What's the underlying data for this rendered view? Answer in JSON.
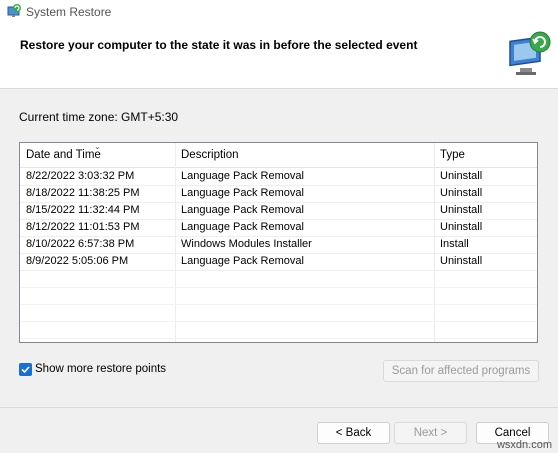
{
  "window": {
    "title": "System Restore",
    "header": "Restore your computer to the state it was in before the selected event"
  },
  "timezone": "Current time zone: GMT+5:30",
  "table": {
    "columns": [
      "Date and Time",
      "Description",
      "Type"
    ],
    "rows": [
      {
        "date": "8/22/2022 3:03:32 PM",
        "description": "Language Pack Removal",
        "type": "Uninstall"
      },
      {
        "date": "8/18/2022 11:38:25 PM",
        "description": "Language Pack Removal",
        "type": "Uninstall"
      },
      {
        "date": "8/15/2022 11:32:44 PM",
        "description": "Language Pack Removal",
        "type": "Uninstall"
      },
      {
        "date": "8/12/2022 11:01:53 PM",
        "description": "Language Pack Removal",
        "type": "Uninstall"
      },
      {
        "date": "8/10/2022 6:57:38 PM",
        "description": "Windows Modules Installer",
        "type": "Install"
      },
      {
        "date": "8/9/2022 5:05:06 PM",
        "description": "Language Pack Removal",
        "type": "Uninstall"
      }
    ]
  },
  "options": {
    "show_more_label": "Show more restore points",
    "show_more_checked": true
  },
  "buttons": {
    "scan": "Scan for affected programs",
    "back": "< Back",
    "next": "Next >",
    "cancel": "Cancel"
  },
  "watermark": "wsxdn.com",
  "colors": {
    "accent": "#1a6fd4"
  }
}
